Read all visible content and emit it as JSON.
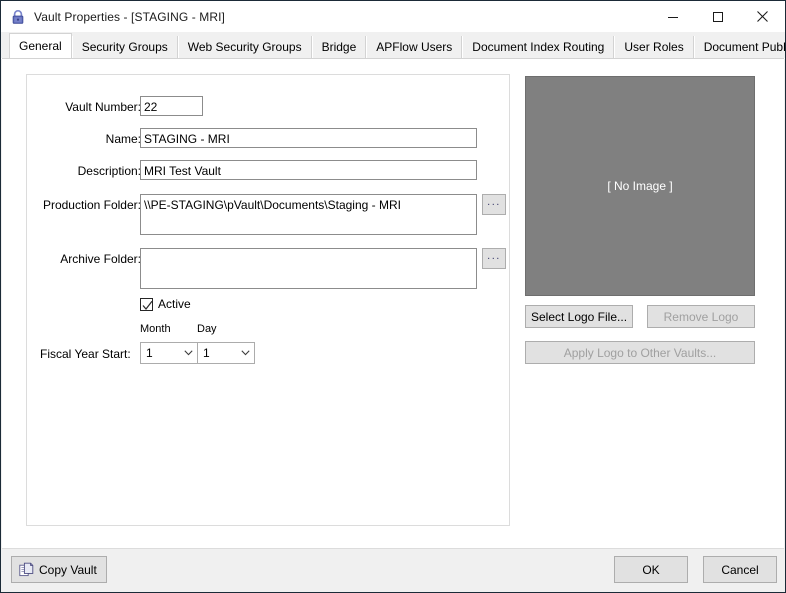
{
  "window": {
    "title": "Vault Properties - [STAGING - MRI]",
    "lock_icon": "lock-icon",
    "controls": {
      "minimize": "minimize-icon",
      "maximize": "maximize-icon",
      "close": "close-icon"
    }
  },
  "tabs": [
    {
      "label": "General",
      "active": true
    },
    {
      "label": "Security Groups",
      "active": false
    },
    {
      "label": "Web Security Groups",
      "active": false
    },
    {
      "label": "Bridge",
      "active": false
    },
    {
      "label": "APFlow Users",
      "active": false
    },
    {
      "label": "Document Index Routing",
      "active": false
    },
    {
      "label": "User Roles",
      "active": false
    },
    {
      "label": "Document Publishing",
      "active": false
    }
  ],
  "form": {
    "vault_number": {
      "label": "Vault Number:",
      "value": "22"
    },
    "name": {
      "label": "Name:",
      "value": "STAGING - MRI"
    },
    "description": {
      "label": "Description:",
      "value": "MRI Test Vault"
    },
    "production_folder": {
      "label": "Production Folder:",
      "value": "\\\\PE-STAGING\\pVault\\Documents\\Staging - MRI",
      "browse_label": "..."
    },
    "archive_folder": {
      "label": "Archive Folder:",
      "value": "",
      "browse_label": "..."
    },
    "active": {
      "label": "Active",
      "checked": true,
      "check_icon": "checkmark-icon"
    },
    "fiscal_year_start": {
      "label": "Fiscal Year Start:",
      "month": {
        "label": "Month",
        "value": "1"
      },
      "day": {
        "label": "Day",
        "value": "1"
      }
    }
  },
  "logo": {
    "placeholder_text": "[ No Image ]",
    "placeholder_color": "#808080",
    "select_label": "Select Logo File...",
    "remove_label": "Remove Logo",
    "apply_label": "Apply Logo to Other Vaults..."
  },
  "footer": {
    "copy_vault_label": "Copy Vault",
    "copy_vault_icon": "copy-pages-icon",
    "ok_label": "OK",
    "cancel_label": "Cancel"
  },
  "colors": {
    "window_chrome": "#f0f0f0",
    "button_face": "#e1e1e1",
    "field_border": "#8c8c8c",
    "accent_lock": "#6b78c4",
    "disabled_text": "#a0a0a0"
  }
}
